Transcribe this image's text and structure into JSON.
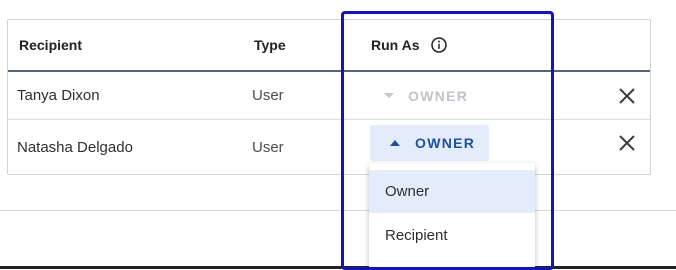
{
  "table": {
    "headers": {
      "recipient": "Recipient",
      "type": "Type",
      "run_as": "Run As"
    },
    "rows": [
      {
        "recipient": "Tanya Dixon",
        "type": "User",
        "run_as": "OWNER",
        "run_as_state": "disabled"
      },
      {
        "recipient": "Natasha Delgado",
        "type": "User",
        "run_as": "OWNER",
        "run_as_state": "open"
      }
    ]
  },
  "dropdown": {
    "options": [
      "Owner",
      "Recipient"
    ],
    "highlighted": "Owner"
  },
  "colors": {
    "accent": "#1f4f9e",
    "accent_bg": "#e3ecfa",
    "highlight_box": "#1414b8",
    "disabled_text": "#c0c4c9"
  },
  "icons": {
    "info": "info-circle-icon",
    "remove": "close-icon",
    "caret_down": "caret-down-icon",
    "caret_up": "caret-up-icon"
  }
}
